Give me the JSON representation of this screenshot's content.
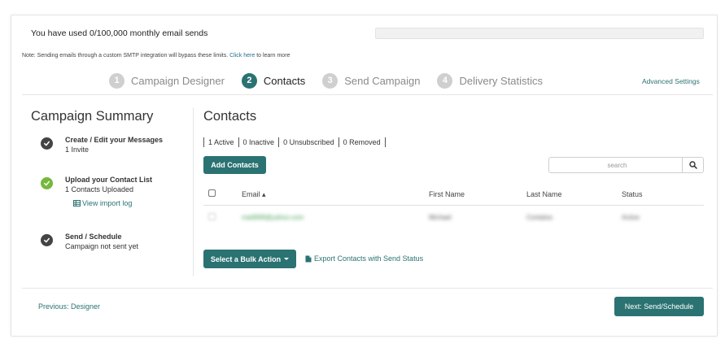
{
  "usage": {
    "text": "You have used 0/100,000 monthly email sends",
    "fraction_used": 0
  },
  "note": {
    "text": "Note: Sending emails through a custom SMTP integration will bypass these limits.",
    "link": "Click here",
    "suffix": "to learn more"
  },
  "steps": [
    {
      "num": "1",
      "label": "Campaign Designer"
    },
    {
      "num": "2",
      "label": "Contacts"
    },
    {
      "num": "3",
      "label": "Send Campaign"
    },
    {
      "num": "4",
      "label": "Delivery Statistics"
    }
  ],
  "advanced_settings": "Advanced Settings",
  "summary": {
    "title": "Campaign Summary",
    "items": [
      {
        "title": "Create / Edit your Messages",
        "sub": "1 Invite"
      },
      {
        "title": "Upload your Contact List",
        "sub": "1 Contacts Uploaded",
        "link": "View import log"
      },
      {
        "title": "Send / Schedule",
        "sub": "Campaign not sent yet"
      }
    ]
  },
  "contacts": {
    "title": "Contacts",
    "filters": [
      "1 Active",
      "0 Inactive",
      "0 Unsubscribed",
      "0 Removed"
    ],
    "add_button": "Add Contacts",
    "search_placeholder": "search",
    "columns": {
      "email": "Email ▴",
      "first": "First Name",
      "last": "Last Name",
      "status": "Status"
    },
    "row": {
      "email": "matt999@yahoo.com",
      "first": "Michael",
      "last": "Contatos",
      "status": "Active"
    },
    "bulk_action": "Select a Bulk Action",
    "export": "Export Contacts with Send Status"
  },
  "footer": {
    "previous": "Previous: Designer",
    "next": "Next: Send/Schedule"
  },
  "colors": {
    "accent": "#2b7272",
    "check_done": "#75b83b",
    "check_pending": "#444444"
  }
}
